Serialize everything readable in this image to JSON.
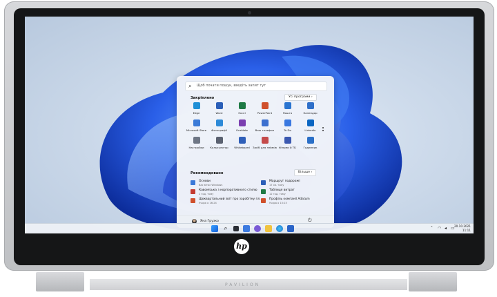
{
  "brand": {
    "logo": "hp",
    "engraving": "PAVILION"
  },
  "start_menu": {
    "search_placeholder": "Щоб почати пошук, введіть запит тут",
    "pinned_title": "Закріплено",
    "all_apps_label": "Усі програми",
    "all_apps_chevron": "›",
    "pinned_apps": [
      {
        "label": "Edge",
        "icon": "edge-icon",
        "color": "#1f8fd6"
      },
      {
        "label": "Word",
        "icon": "word-icon",
        "color": "#2b5fb8"
      },
      {
        "label": "Excel",
        "icon": "excel-icon",
        "color": "#1f7a45"
      },
      {
        "label": "PowerPoint",
        "icon": "powerpoint-icon",
        "color": "#d0502c"
      },
      {
        "label": "Пошта",
        "icon": "mail-icon",
        "color": "#2a74d0"
      },
      {
        "label": "Календар",
        "icon": "calendar-icon",
        "color": "#2e6fc9"
      },
      {
        "label": "Microsoft Store",
        "icon": "store-icon",
        "color": "#3b7bd8"
      },
      {
        "label": "Фотографії",
        "icon": "photos-icon",
        "color": "#2d8ad8"
      },
      {
        "label": "OneNote",
        "icon": "onenote-icon",
        "color": "#7b3fb0"
      },
      {
        "label": "Ваш телефон",
        "icon": "phone-icon",
        "color": "#3b6fcf"
      },
      {
        "label": "To Do",
        "icon": "todo-icon",
        "color": "#3a78e0"
      },
      {
        "label": "LinkedIn",
        "icon": "linkedin-icon",
        "color": "#0a66c2"
      },
      {
        "label": "Настройки",
        "icon": "settings-icon",
        "color": "#6e7685"
      },
      {
        "label": "Калькулятор",
        "icon": "calculator-icon",
        "color": "#5a6170"
      },
      {
        "label": "Whiteboard",
        "icon": "whiteboard-icon",
        "color": "#2f5fb8"
      },
      {
        "label": "Засіб для знімків",
        "icon": "snipping-tool-icon",
        "color": "#c44a4a"
      },
      {
        "label": "Фільми й ТБ",
        "icon": "movies-tv-icon",
        "color": "#3b58b0"
      },
      {
        "label": "Годинник",
        "icon": "clock-icon",
        "color": "#2a6fc7"
      }
    ],
    "recommended_title": "Рекомендовано",
    "more_label": "Більше",
    "more_chevron": "›",
    "recommended": [
      {
        "title": "Основи",
        "subtitle": "Вас вітає Windows",
        "icon": "tips-icon",
        "color": "#3a78d8"
      },
      {
        "title": "Маршрут подорожі",
        "subtitle": "17 хв. тому",
        "icon": "word-doc-icon",
        "color": "#2b5fb8"
      },
      {
        "title": "Кавоміська з корпоративного стилю",
        "subtitle": "2 год. тому",
        "icon": "pdf-icon",
        "color": "#c43a30"
      },
      {
        "title": "Таблиця витрат",
        "subtitle": "12 год. тому",
        "icon": "excel-doc-icon",
        "color": "#1f7a45"
      },
      {
        "title": "Щоквартальний звіт про заробітну пл…",
        "subtitle": "Учора о 16:24",
        "icon": "ppt-doc-icon",
        "color": "#d0502c"
      },
      {
        "title": "Профіль компанії Adatum",
        "subtitle": "Учора о 15:15",
        "icon": "ppt-doc-icon",
        "color": "#d0502c"
      }
    ],
    "user_name": "Яна Грузко"
  },
  "taskbar": {
    "apps": [
      "windows-start-icon",
      "search-icon",
      "task-view-icon",
      "widgets-icon",
      "chat-icon",
      "file-explorer-icon",
      "edge-icon",
      "store-icon"
    ],
    "clock_time": "11:11",
    "clock_date": "20.10.2021"
  }
}
